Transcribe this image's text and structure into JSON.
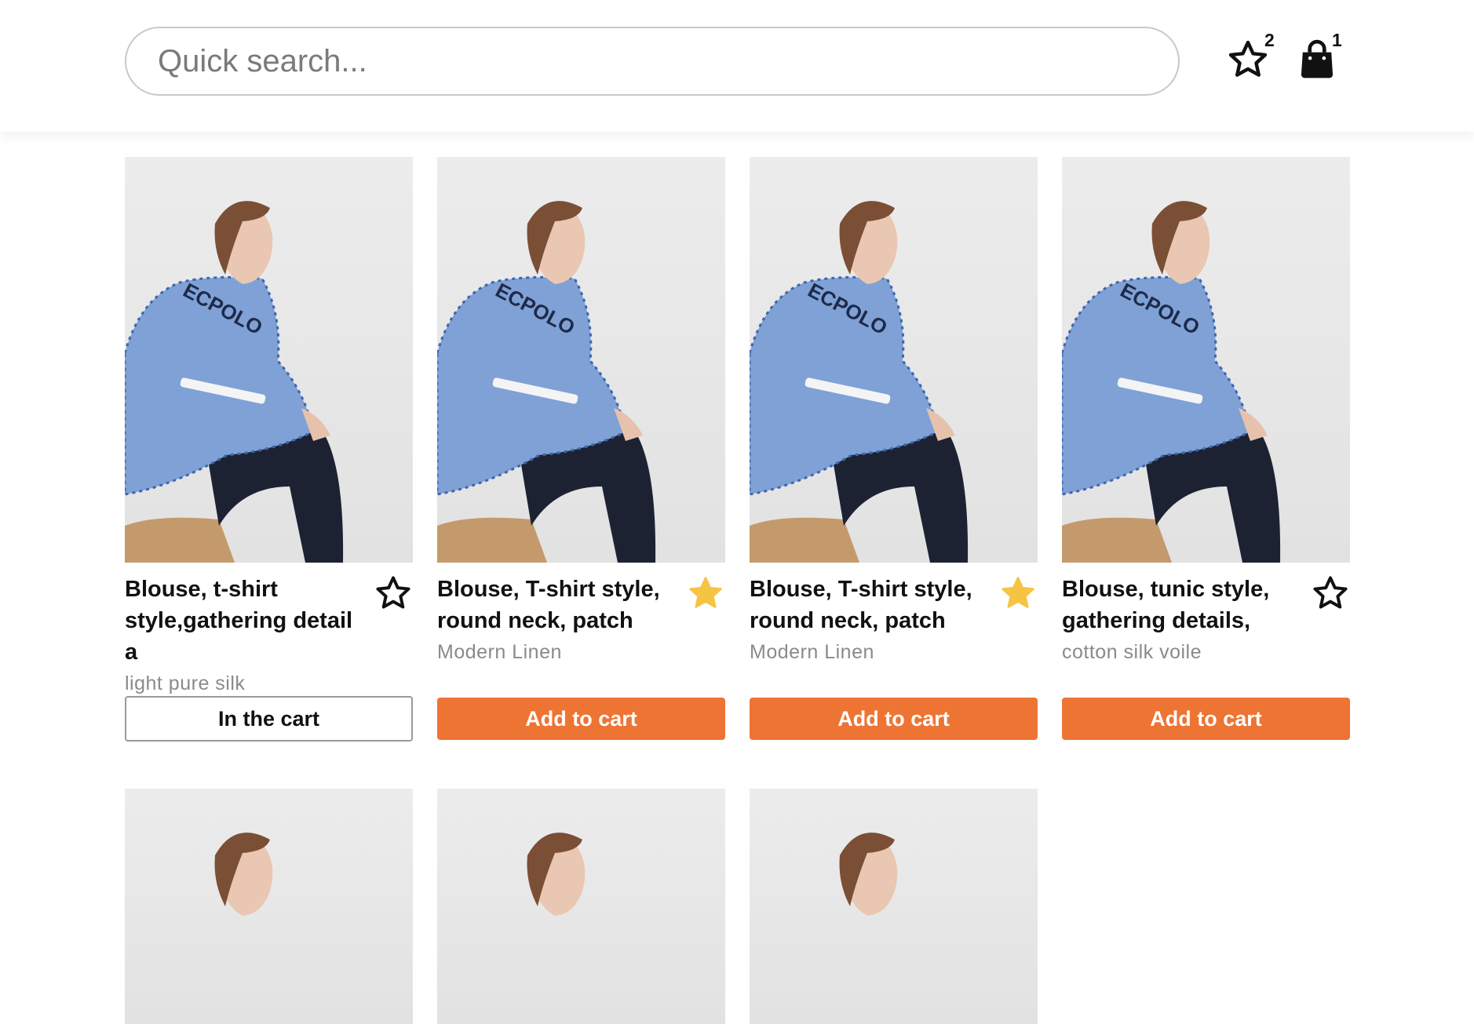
{
  "header": {
    "search_placeholder": "Quick search...",
    "favorites": {
      "icon": "star-outline-icon",
      "count": "2"
    },
    "cart": {
      "icon": "shopping-bag-icon",
      "count": "1"
    }
  },
  "colors": {
    "accent": "#ee7433",
    "favorite_active": "#f6c443",
    "muted_text": "#8a8a8a"
  },
  "products": [
    {
      "title": "Blouse, t-shirt style,gathering detail a",
      "material": "light pure silk",
      "favorite": false,
      "button_label": "In the cart",
      "in_cart": true
    },
    {
      "title": "Blouse, T-shirt style, round neck, patch",
      "material": "Modern Linen",
      "favorite": true,
      "button_label": "Add to cart",
      "in_cart": false
    },
    {
      "title": "Blouse, T-shirt style, round neck, patch",
      "material": "Modern Linen",
      "favorite": true,
      "button_label": "Add to cart",
      "in_cart": false
    },
    {
      "title": "Blouse, tunic style, gathering details,",
      "material": "cotton silk voile",
      "favorite": false,
      "button_label": "Add to cart",
      "in_cart": false
    }
  ]
}
